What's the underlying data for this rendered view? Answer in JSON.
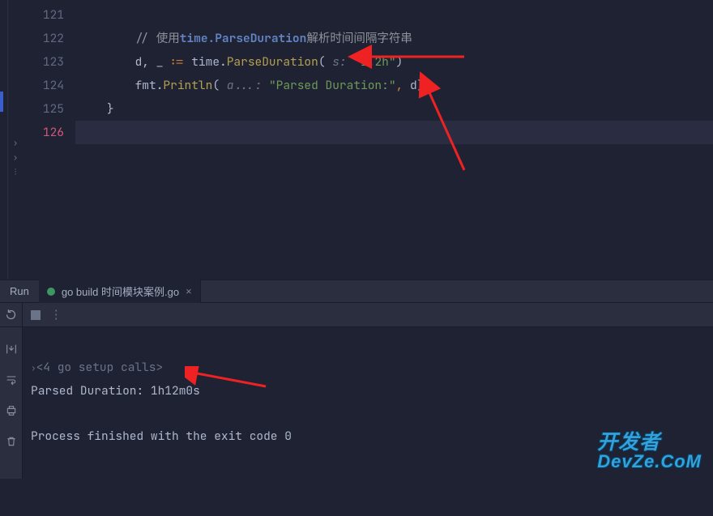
{
  "lines": {
    "l121": "121",
    "l122": "122",
    "l123": "123",
    "l124": "124",
    "l125": "125",
    "l126": "126"
  },
  "code": {
    "comment_prefix": "// 使用",
    "comment_bold": "time.ParseDuration",
    "comment_suffix": "解析时间间隔字符串",
    "assign_lhs": "d, _ ",
    "assign_op": ":=",
    "pkg_time": " time",
    "dot1": ".",
    "parse_fn": "ParseDuration",
    "open_paren1": "(",
    "hint1": " s: ",
    "str1": "\"1.2h\"",
    "close_paren1": ")",
    "pkg_fmt": "fmt",
    "dot2": ".",
    "println_fn": "Println",
    "open_paren2": "(",
    "hint2": " a...: ",
    "str2": "\"Parsed Duration:\"",
    "comma": ", ",
    "arg_d": "d",
    "close_paren2": ")",
    "close_brace": "}"
  },
  "run_label": "Run",
  "tab": {
    "label": "go build 时间模块案例.go",
    "close": "×"
  },
  "console": {
    "setup": "<4 go setup calls>",
    "output": "Parsed Duration: 1h12m0s",
    "exit": "Process finished with the exit code 0"
  },
  "watermark": {
    "l1": "开发者",
    "l2": "DevZe.CoM"
  }
}
